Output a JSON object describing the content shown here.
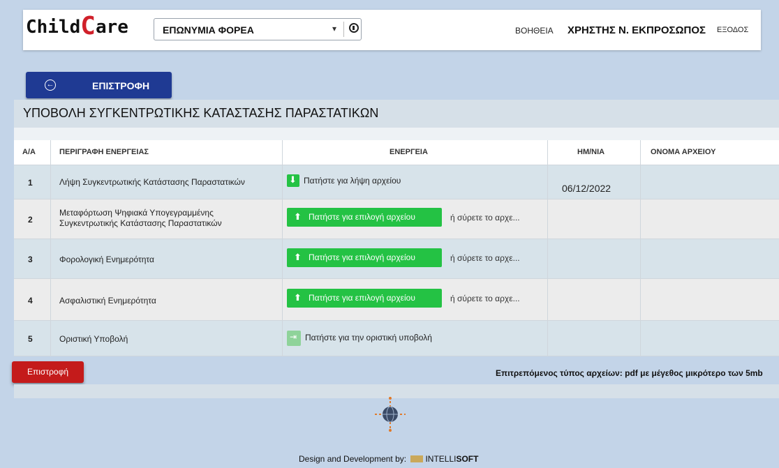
{
  "app": {
    "logo_prefix": "Child",
    "logo_cap": "C",
    "logo_suffix": "are",
    "org_select_value": "ΕΠΩΝΥΜΙΑ ΦΟΡΕΑ",
    "help_label": "ΒΟΗΘΕΙΑ",
    "user_name": "ΧΡΗΣΤΗΣ Ν. ΕΚΠΡΟΣΩΠΟΣ",
    "exit_label": "ΕΞΟΔΟΣ"
  },
  "back_button_label": "ΕΠΙΣΤΡΟΦΗ",
  "page_title": "ΥΠΟΒΟΛΗ ΣΥΓΚΕΝΤΡΩΤΙΚΗΣ ΚΑΤΑΣΤΑΣΗΣ ΠΑΡΑΣΤΑΤΙΚΩΝ",
  "table": {
    "headers": [
      "Α/Α",
      "ΠΕΡΙΓΡΑΦΗ ΕΝΕΡΓΕΙΑΣ",
      "ΕΝΕΡΓΕΙΑ",
      "ΗΜ/ΝΙΑ",
      "ΟΝΟΜΑ ΑΡΧΕΙΟΥ"
    ],
    "rows": [
      {
        "num": "1",
        "desc": "Λήψη Συγκεντρωτικής Κατάστασης Παραστατικών",
        "action": "Πατήστε για λήψη αρχείου",
        "date": "06/12/2022",
        "file": ""
      },
      {
        "num": "2",
        "desc": "Μεταφόρτωση Ψηφιακά Υπογεγραμμένης Συγκεντρωτικής Κατάστασης Παραστατικών",
        "action": "Πατήστε για επιλογή αρχείου",
        "drop": "ή σύρετε το αρχε...",
        "date": "",
        "file": ""
      },
      {
        "num": "3",
        "desc": "Φορολογική Ενημερότητα",
        "action": "Πατήστε για επιλογή αρχείου",
        "drop": "ή σύρετε το αρχε...",
        "date": "",
        "file": ""
      },
      {
        "num": "4",
        "desc": "Ασφαλιστική Ενημερότητα",
        "action": "Πατήστε για επιλογή αρχείου",
        "drop": "ή σύρετε το αρχε...",
        "date": "",
        "file": ""
      },
      {
        "num": "5",
        "desc": "Οριστική Υποβολή",
        "action": "Πατήστε για την οριστική υποβολή",
        "date": "",
        "file": ""
      }
    ]
  },
  "bottom": {
    "back_label": "Επιστροφή",
    "allowed_types": "Επιτρεπόμενος τύπος αρχείων: pdf με μέγεθος μικρότερο των 5mb"
  },
  "footer": {
    "credit_prefix": "Design and Development by:",
    "credit_brand_light": "INTELLI",
    "credit_brand_bold": "SOFT"
  },
  "colors": {
    "page_bg": "#c3d4e8",
    "primary_blue": "#1f3a93",
    "green": "#24c244",
    "red": "#c41b1b",
    "logo_red": "#d0202a"
  }
}
